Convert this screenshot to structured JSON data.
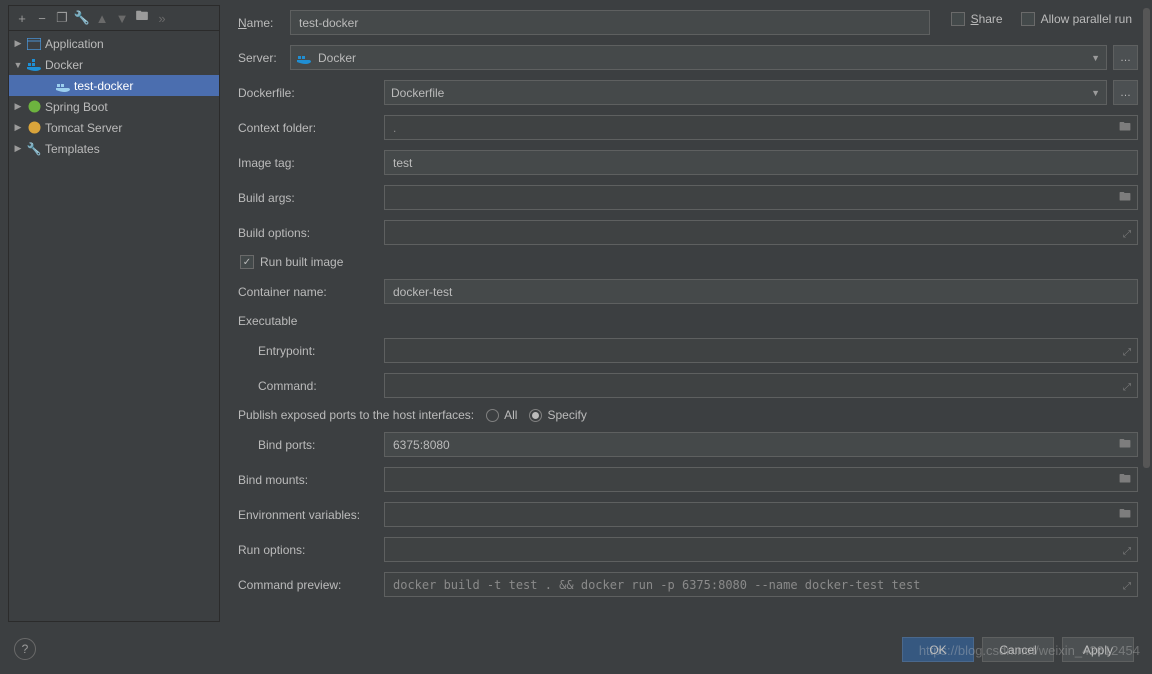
{
  "toolbar": {
    "add": "+",
    "remove": "−",
    "copy": "❐",
    "wrench": "🔧",
    "up": "▲",
    "down": "▼",
    "folder": "🖿",
    "more": "»"
  },
  "tree": {
    "items": [
      {
        "label": "Application",
        "icon": "app",
        "expand": "▶",
        "level": 1
      },
      {
        "label": "Docker",
        "icon": "docker",
        "expand": "▼",
        "level": 1
      },
      {
        "label": "test-docker",
        "icon": "docker-run",
        "expand": "",
        "level": 3,
        "selected": true
      },
      {
        "label": "Spring Boot",
        "icon": "spring",
        "expand": "▶",
        "level": 1
      },
      {
        "label": "Tomcat Server",
        "icon": "tomcat",
        "expand": "▶",
        "level": 1
      },
      {
        "label": "Templates",
        "icon": "wrench",
        "expand": "▶",
        "level": 1
      }
    ]
  },
  "header": {
    "name_label": "Name:",
    "name_value": "test-docker",
    "share_label": "Share",
    "parallel_label": "Allow parallel run"
  },
  "form": {
    "server_label": "Server:",
    "server_value": "Docker",
    "dockerfile_label": "Dockerfile:",
    "dockerfile_value": "Dockerfile",
    "context_label": "Context folder:",
    "context_value": ".",
    "image_tag_label": "Image tag:",
    "image_tag_value": "test",
    "build_args_label": "Build args:",
    "build_args_value": "",
    "build_options_label": "Build options:",
    "build_options_value": "",
    "run_built_label": "Run built image",
    "container_name_label": "Container name:",
    "container_name_value": "docker-test",
    "executable_label": "Executable",
    "entrypoint_label": "Entrypoint:",
    "entrypoint_value": "",
    "command_label": "Command:",
    "command_value": "",
    "publish_label": "Publish exposed ports to the host interfaces:",
    "radio_all": "All",
    "radio_specify": "Specify",
    "bind_ports_label": "Bind ports:",
    "bind_ports_value": "6375:8080",
    "bind_mounts_label": "Bind mounts:",
    "bind_mounts_value": "",
    "env_label": "Environment variables:",
    "env_value": "",
    "run_options_label": "Run options:",
    "run_options_value": "",
    "preview_label": "Command preview:",
    "preview_value": "docker build -t test . && docker run -p 6375:8080 --name docker-test test"
  },
  "buttons": {
    "ok": "OK",
    "cancel": "Cancel",
    "apply": "Apply"
  },
  "watermark": "https://blog.csdn.net/weixin_42612454"
}
